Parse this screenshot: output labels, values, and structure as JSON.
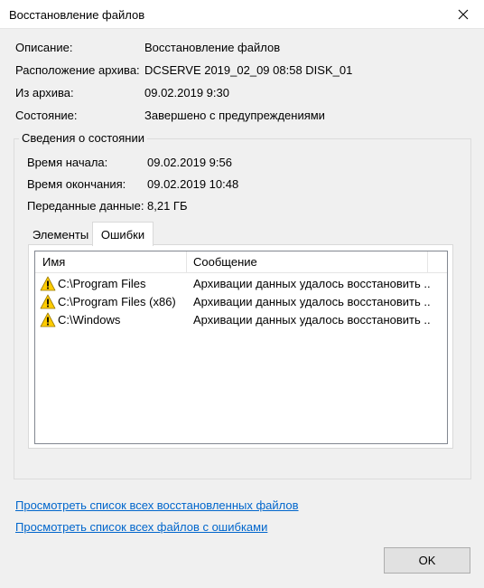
{
  "window": {
    "title": "Восстановление файлов"
  },
  "info": [
    {
      "label": "Описание:",
      "value": "Восстановление файлов"
    },
    {
      "label": "Расположение архива:",
      "value": "DCSERVE 2019_02_09 08:58 DISK_01"
    },
    {
      "label": "Из архива:",
      "value": "09.02.2019 9:30"
    },
    {
      "label": "Состояние:",
      "value": "Завершено с предупреждениями"
    }
  ],
  "status": {
    "legend": "Сведения о состоянии",
    "rows": [
      {
        "label": "Время начала:",
        "value": "09.02.2019 9:56"
      },
      {
        "label": "Время окончания:",
        "value": "09.02.2019 10:48"
      },
      {
        "label": "Переданные данные:",
        "value": "8,21 ГБ"
      }
    ]
  },
  "tabs": [
    {
      "label": "Элементы",
      "selected": false
    },
    {
      "label": "Ошибки",
      "selected": true
    }
  ],
  "errors_list": {
    "columns": [
      "Имя",
      "Сообщение"
    ],
    "rows": [
      {
        "icon": "warning-icon",
        "name": "C:\\Program Files",
        "message": "Архивации данных удалось восстановить ..."
      },
      {
        "icon": "warning-icon",
        "name": "C:\\Program Files (x86)",
        "message": "Архивации данных удалось восстановить ..."
      },
      {
        "icon": "warning-icon",
        "name": "C:\\Windows",
        "message": "Архивации данных удалось восстановить ..."
      }
    ]
  },
  "links": {
    "restored": "Просмотреть список всех восстановленных файлов",
    "errors": "Просмотреть список всех файлов с ошибками"
  },
  "buttons": {
    "ok": "OK"
  },
  "colors": {
    "link": "#0066cc",
    "warning": "#ffcc00"
  }
}
